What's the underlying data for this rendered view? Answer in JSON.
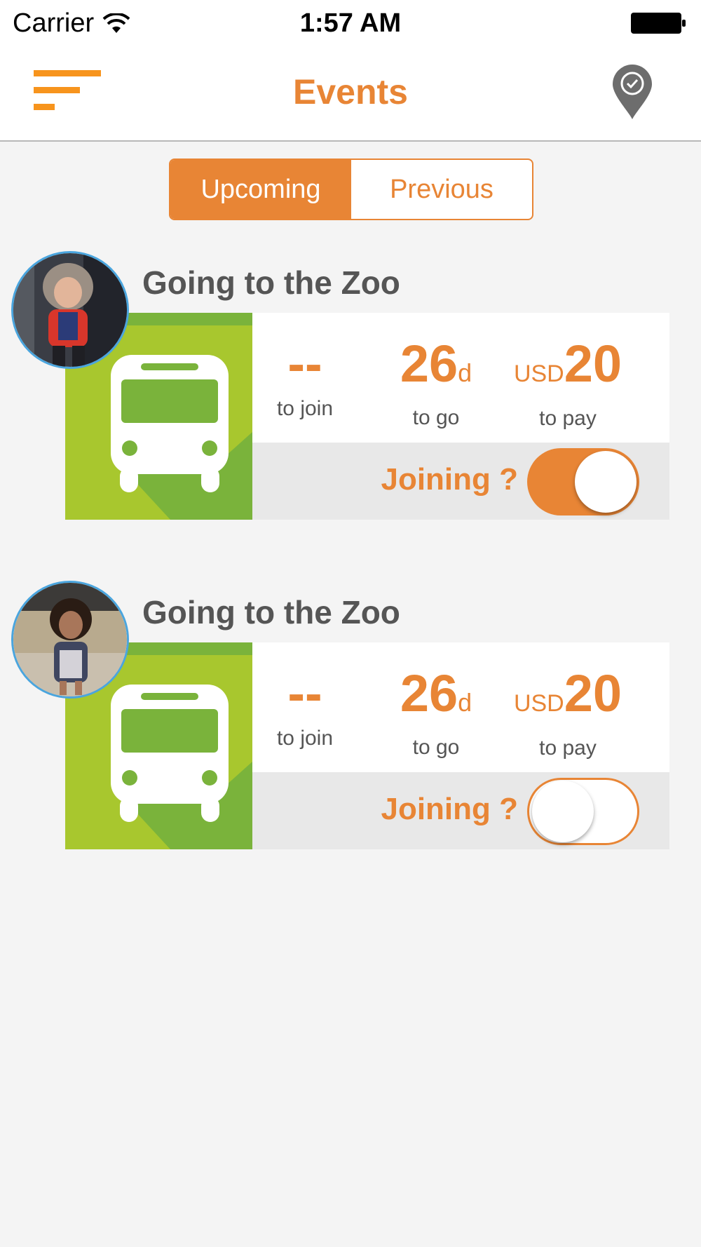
{
  "status_bar": {
    "carrier": "Carrier",
    "time": "1:57 AM"
  },
  "nav": {
    "title": "Events",
    "menu_icon": "menu-lines-icon",
    "map_icon": "location-check-icon"
  },
  "segments": {
    "upcoming": "Upcoming",
    "previous": "Previous",
    "selected": "Upcoming"
  },
  "colors": {
    "accent": "#e88535",
    "tile_green": "#a8c72e",
    "tile_dark_green": "#7ab33b",
    "toggle_bg": "#e8e8e8"
  },
  "events": [
    {
      "title": "Going to the Zoo",
      "join_value": "--",
      "join_label": "to join",
      "go_value": "26",
      "go_unit": "d",
      "go_label": "to go",
      "pay_currency": "USD",
      "pay_value": "20",
      "pay_label": "to pay",
      "joining_label": "Joining ?",
      "joining": true
    },
    {
      "title": "Going to the Zoo",
      "join_value": "--",
      "join_label": "to join",
      "go_value": "26",
      "go_unit": "d",
      "go_label": "to go",
      "pay_currency": "USD",
      "pay_value": "20",
      "pay_label": "to pay",
      "joining_label": "Joining ?",
      "joining": false
    }
  ]
}
